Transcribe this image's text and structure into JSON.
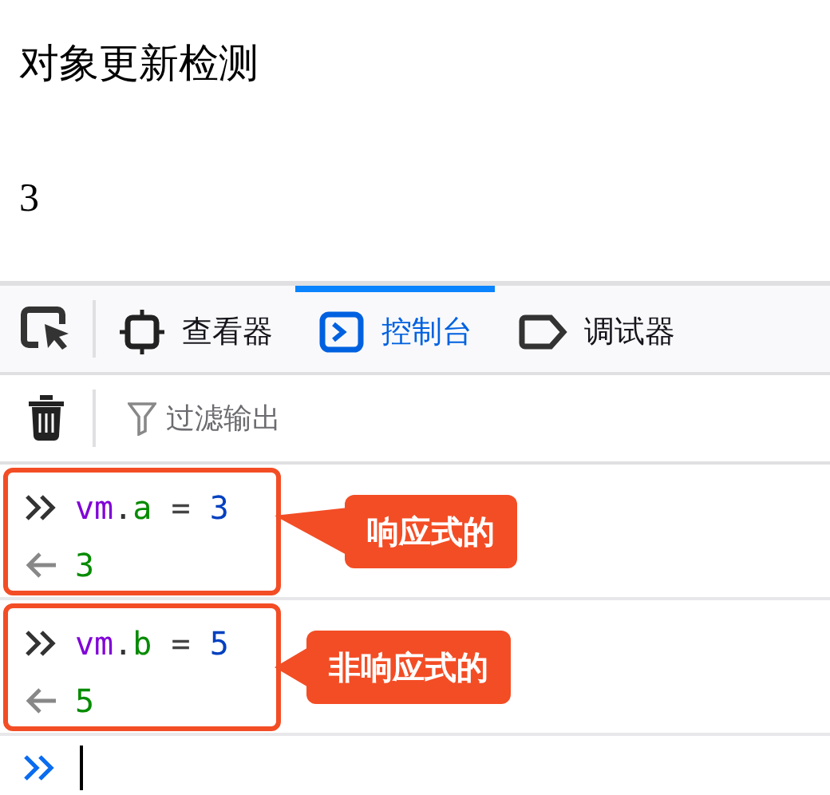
{
  "page": {
    "heading": "对象更新检测",
    "value": "3"
  },
  "toolbar": {
    "tabs": [
      {
        "label": "查看器",
        "kind": "inspector",
        "selected": false
      },
      {
        "label": "控制台",
        "kind": "console",
        "selected": true
      },
      {
        "label": "调试器",
        "kind": "debugger",
        "selected": false
      }
    ]
  },
  "filter": {
    "placeholder": "过滤输出"
  },
  "console": {
    "entries": [
      {
        "input": [
          {
            "text": "vm",
            "kind": "variable"
          },
          {
            "text": ".",
            "kind": "punct"
          },
          {
            "text": "a",
            "kind": "property"
          },
          {
            "text": " = ",
            "kind": "operator"
          },
          {
            "text": "3",
            "kind": "number"
          }
        ],
        "result": "3",
        "callout": "响应式的"
      },
      {
        "input": [
          {
            "text": "vm",
            "kind": "variable"
          },
          {
            "text": ".",
            "kind": "punct"
          },
          {
            "text": "b",
            "kind": "property"
          },
          {
            "text": " = ",
            "kind": "operator"
          },
          {
            "text": "5",
            "kind": "number"
          }
        ],
        "result": "5",
        "callout": "非响应式的"
      }
    ]
  }
}
